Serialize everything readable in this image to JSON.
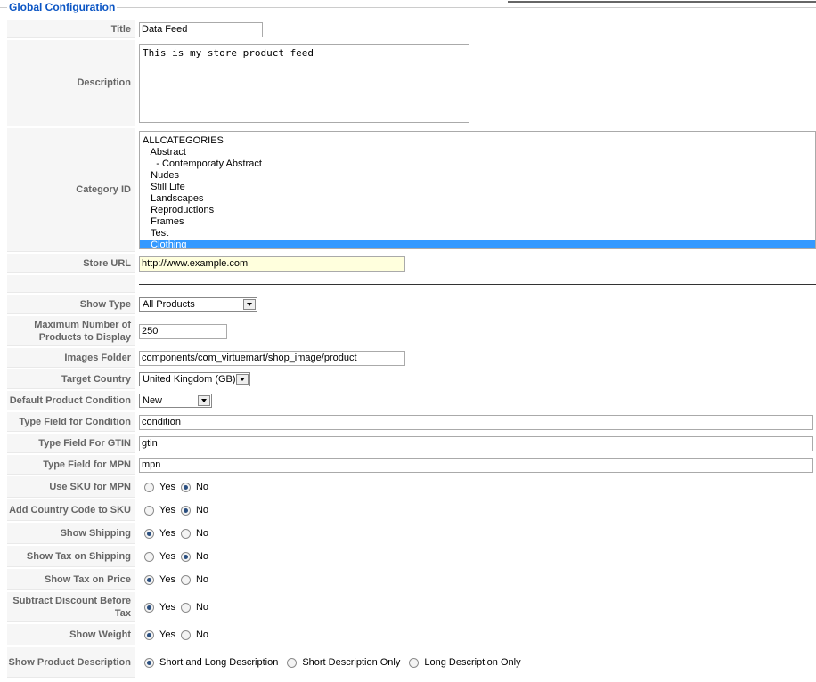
{
  "legend": "Global Configuration",
  "fields": {
    "title": {
      "label": "Title",
      "value": "Data Feed"
    },
    "description": {
      "label": "Description",
      "value": "This is my store product feed"
    },
    "category": {
      "label": "Category ID",
      "options": [
        "ALLCATEGORIES",
        "   Abstract",
        "     - Contemporaty Abstract",
        "   Nudes",
        "   Still Life",
        "   Landscapes",
        "   Reproductions",
        "   Frames",
        "   Test",
        "   Clothing"
      ],
      "selected_index": 9
    },
    "store_url": {
      "label": "Store URL",
      "value": "http://www.example.com"
    },
    "show_type": {
      "label": "Show Type",
      "value": "All Products"
    },
    "max_products": {
      "label": "Maximum Number of Products to Display",
      "value": "250"
    },
    "images_folder": {
      "label": "Images Folder",
      "value": "components/com_virtuemart/shop_image/product"
    },
    "target_country": {
      "label": "Target Country",
      "value": "United Kingdom (GB)"
    },
    "default_condition": {
      "label": "Default Product Condition",
      "value": "New"
    },
    "type_condition": {
      "label": "Type Field for Condition",
      "value": "condition"
    },
    "type_gtin": {
      "label": "Type Field For GTIN",
      "value": "gtin"
    },
    "type_mpn": {
      "label": "Type Field for MPN",
      "value": "mpn"
    }
  },
  "radios": {
    "yes": "Yes",
    "no": "No",
    "use_sku_mpn": {
      "label": "Use SKU for MPN",
      "selected": "no"
    },
    "add_country_code": {
      "label": "Add Country Code to SKU",
      "selected": "no"
    },
    "show_shipping": {
      "label": "Show Shipping",
      "selected": "yes"
    },
    "show_tax_shipping": {
      "label": "Show Tax on Shipping",
      "selected": "no"
    },
    "show_tax_price": {
      "label": "Show Tax on Price",
      "selected": "yes"
    },
    "subtract_discount": {
      "label": "Subtract Discount Before Tax",
      "selected": "yes"
    },
    "show_weight": {
      "label": "Show Weight",
      "selected": "yes"
    },
    "show_description": {
      "label": "Show Product Description",
      "options": [
        "Short and Long Description",
        "Short Description Only",
        "Long Description Only"
      ],
      "selected_index": 0
    }
  },
  "colors": {
    "legend": "#0b55c4",
    "selection": "#3399ff",
    "url_bg": "#ffffdd"
  }
}
